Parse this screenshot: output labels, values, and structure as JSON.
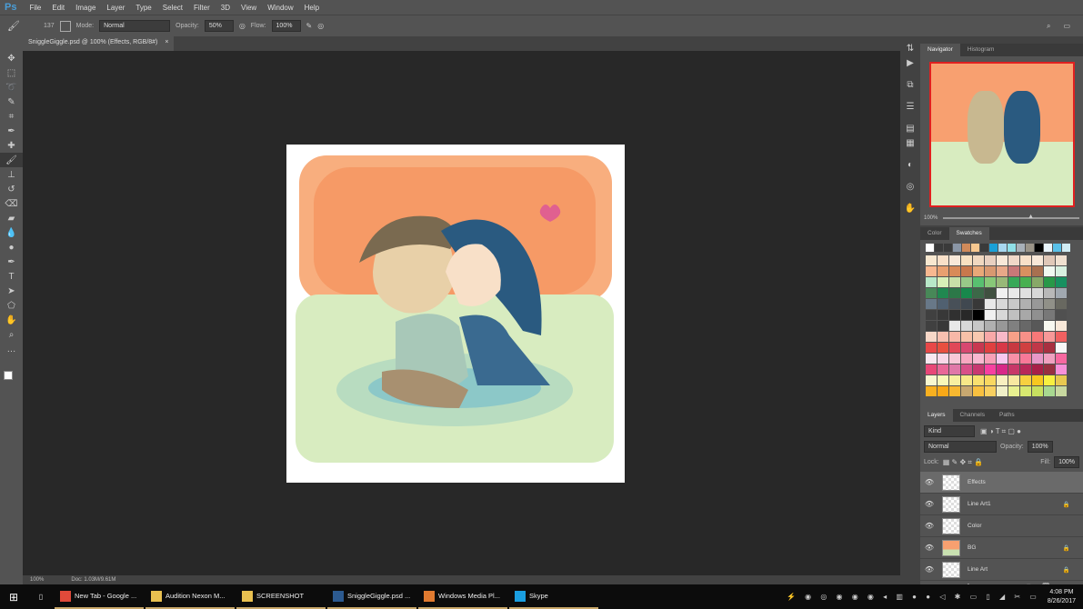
{
  "app": {
    "logo": "Ps",
    "menu": [
      "File",
      "Edit",
      "Image",
      "Layer",
      "Type",
      "Select",
      "Filter",
      "3D",
      "View",
      "Window",
      "Help"
    ]
  },
  "options": {
    "brush_size": "137",
    "mode_label": "Mode:",
    "mode": "Normal",
    "opacity_label": "Opacity:",
    "opacity": "50%",
    "flow_label": "Flow:",
    "flow": "100%"
  },
  "document": {
    "tab_title": "SniggleGiggle.psd @ 100% (Effects, RGB/8#)",
    "zoom": "100%",
    "doc_size": "Doc: 1.03M/9.61M"
  },
  "tools": [
    "move",
    "marquee",
    "lasso",
    "quick-select",
    "crop",
    "eyedropper",
    "healing",
    "brush",
    "stamp",
    "history-brush",
    "eraser",
    "gradient",
    "blur",
    "dodge",
    "pen",
    "type",
    "path-select",
    "shape",
    "hand",
    "zoom",
    "more"
  ],
  "navigator": {
    "tabs": [
      "Navigator",
      "Histogram"
    ],
    "zoom": "100%"
  },
  "swatches": {
    "tabs": [
      "Color",
      "Swatches"
    ],
    "recent": [
      "#ffffff",
      "#3a3a3a",
      "#3a3a3a",
      "#8a96a6",
      "#d08a5a",
      "#f8c890",
      "#3a3a3a",
      "#1aa0d8",
      "#a8d8f0",
      "#90e0e8",
      "#a8b0b8",
      "#9a9488",
      "#000000",
      "#e8f4fa",
      "#58c0e8",
      "#d0ecf4"
    ]
  },
  "layers": {
    "tabs": [
      "Layers",
      "Channels",
      "Paths"
    ],
    "kind": "Kind",
    "blend": "Normal",
    "opacity_label": "Opacity:",
    "opacity": "100%",
    "lock_label": "Lock:",
    "fill_label": "Fill:",
    "fill": "100%",
    "items": [
      {
        "name": "Effects",
        "locked": false,
        "selected": true
      },
      {
        "name": "Line Art1",
        "locked": true,
        "selected": false
      },
      {
        "name": "Color",
        "locked": false,
        "selected": false
      },
      {
        "name": "BG",
        "locked": true,
        "selected": false
      },
      {
        "name": "Line Art",
        "locked": true,
        "selected": false
      }
    ]
  },
  "taskbar": {
    "items": [
      {
        "label": "New Tab - Google ...",
        "color": "#e04a3a"
      },
      {
        "label": "Audition Nexon M...",
        "color": "#e8c050"
      },
      {
        "label": "SCREENSHOT",
        "color": "#e8c050"
      },
      {
        "label": "SniggleGiggle.psd ...",
        "color": "#2c5a90"
      },
      {
        "label": "Windows Media Pl...",
        "color": "#e07a30"
      },
      {
        "label": "Skype",
        "color": "#1a9ee0"
      }
    ],
    "time": "4:08 PM",
    "date": "8/26/2017"
  }
}
